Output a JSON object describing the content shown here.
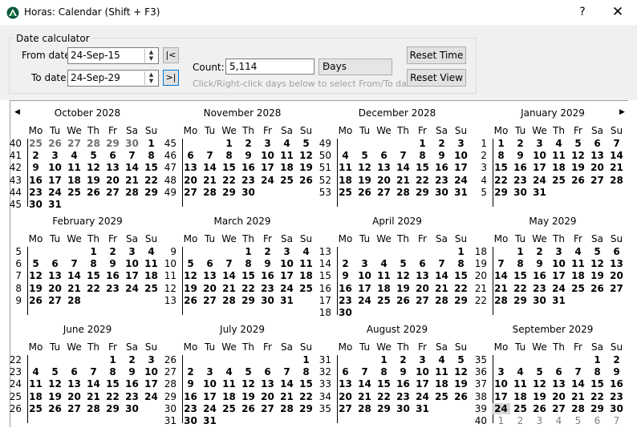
{
  "window": {
    "title": "Horas: Calendar (Shift + F3)",
    "help": "?",
    "close": "✕"
  },
  "calculator": {
    "group_label": "Date calculator",
    "from_label": "From date:",
    "from_value": "24-Sep-15",
    "to_label": "To date:",
    "to_value": "24-Sep-29",
    "first_btn": "|<",
    "last_btn": ">|",
    "count_label": "Count:",
    "count_value": "5,114",
    "unit_value": "Days",
    "hint": "Click/Right-click days below to select From/To dates",
    "reset_time": "Reset Time",
    "reset_view": "Reset View"
  },
  "nav": {
    "prev": "◀",
    "next": "▶"
  },
  "dow": [
    "Mo",
    "Tu",
    "We",
    "Th",
    "Fr",
    "Sa",
    "Su"
  ],
  "months": [
    {
      "name": "October 2028",
      "weeks": [
        40,
        41,
        42,
        43,
        44,
        45
      ],
      "start": 0,
      "days": 31,
      "lead": [
        25,
        26,
        27,
        28,
        29,
        30
      ],
      "trail": []
    },
    {
      "name": "November 2028",
      "weeks": [
        45,
        46,
        47,
        48,
        49
      ],
      "start": 2,
      "days": 30,
      "lead": [],
      "trail": []
    },
    {
      "name": "December 2028",
      "weeks": [
        49,
        50,
        51,
        52,
        53
      ],
      "start": 4,
      "days": 31,
      "lead": [],
      "trail": []
    },
    {
      "name": "January 2029",
      "weeks": [
        1,
        2,
        3,
        4,
        5
      ],
      "start": 0,
      "days": 31,
      "lead": [],
      "trail": []
    },
    {
      "name": "February 2029",
      "weeks": [
        5,
        6,
        7,
        8,
        9
      ],
      "start": 3,
      "days": 28,
      "lead": [],
      "trail": []
    },
    {
      "name": "March 2029",
      "weeks": [
        9,
        10,
        11,
        12,
        13
      ],
      "start": 3,
      "days": 31,
      "lead": [],
      "trail": []
    },
    {
      "name": "April 2029",
      "weeks": [
        13,
        14,
        15,
        16,
        17,
        18
      ],
      "start": 6,
      "days": 30,
      "lead": [],
      "trail": []
    },
    {
      "name": "May 2029",
      "weeks": [
        18,
        19,
        20,
        21,
        22
      ],
      "start": 1,
      "days": 31,
      "lead": [],
      "trail": []
    },
    {
      "name": "June 2029",
      "weeks": [
        22,
        23,
        24,
        25,
        26
      ],
      "start": 4,
      "days": 30,
      "lead": [],
      "trail": []
    },
    {
      "name": "July 2029",
      "weeks": [
        26,
        27,
        28,
        29,
        30,
        31
      ],
      "start": 6,
      "days": 31,
      "lead": [],
      "trail": []
    },
    {
      "name": "August 2029",
      "weeks": [
        31,
        32,
        33,
        34,
        35
      ],
      "start": 2,
      "days": 31,
      "lead": [],
      "trail": []
    },
    {
      "name": "September 2029",
      "weeks": [
        35,
        36,
        37,
        38,
        39,
        40
      ],
      "start": 5,
      "days": 30,
      "lead": [],
      "trail": [
        1,
        2,
        3,
        4,
        5,
        6,
        7
      ],
      "selected": 24
    }
  ]
}
